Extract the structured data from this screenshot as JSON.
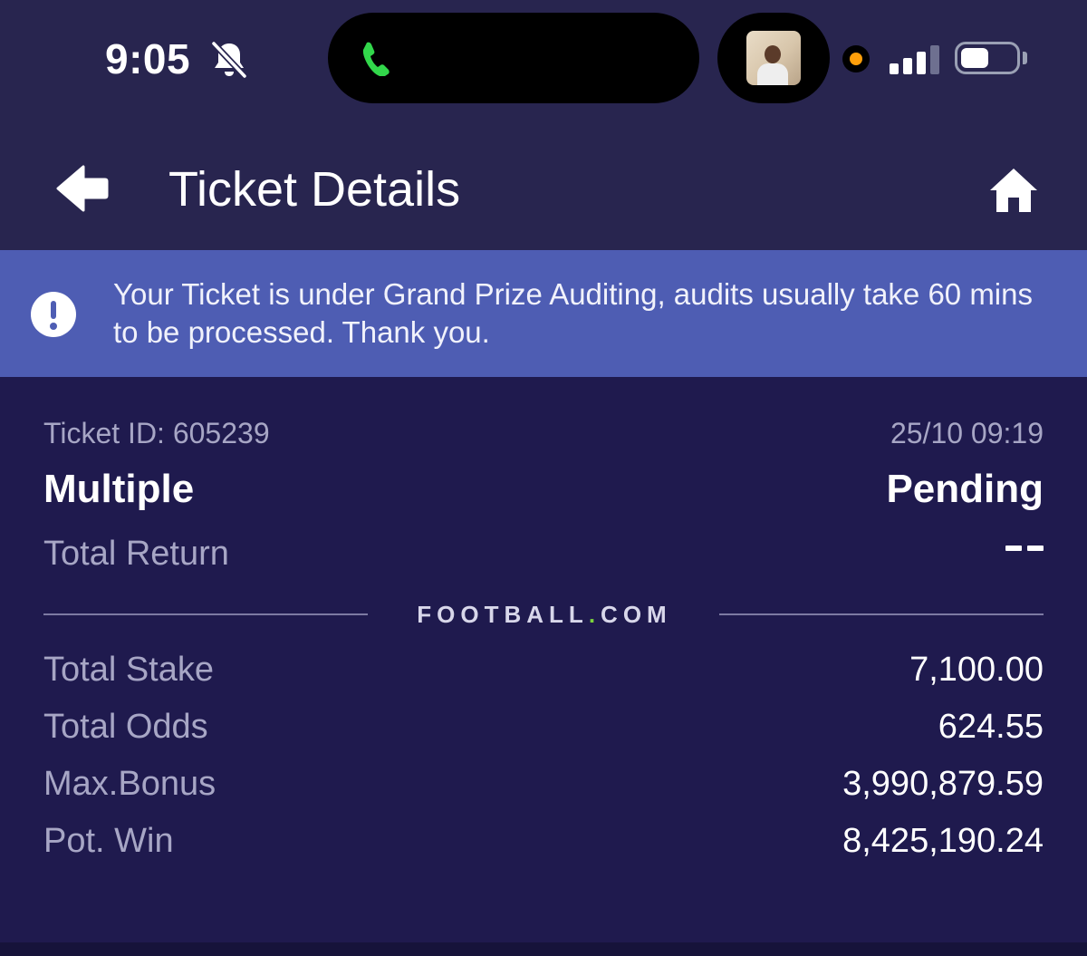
{
  "status_bar": {
    "time": "9:05",
    "icons": [
      "bell-slash-icon",
      "phone-icon",
      "camera-thumbnail",
      "mic-indicator-icon",
      "signal-icon",
      "battery-icon"
    ],
    "call_color": "#32d74b",
    "indicator_color": "#ff9f0a"
  },
  "header": {
    "title": "Ticket Details",
    "back_icon": "arrow-left-icon",
    "home_icon": "home-icon"
  },
  "banner": {
    "icon": "exclamation-icon",
    "text": "Your Ticket is under Grand Prize Auditing, audits usually take 60 mins to be processed. Thank you.",
    "color": "#4e5db3"
  },
  "ticket": {
    "id_label": "Ticket ID: 605239",
    "datetime": "25/10 09:19",
    "type": "Multiple",
    "status": "Pending",
    "total_return_label": "Total Return",
    "total_return_value": "--",
    "brand_left": "FOOTBALL",
    "brand_dot": ".",
    "brand_right": "COM",
    "rows": [
      {
        "label": "Total Stake",
        "value": "7,100.00"
      },
      {
        "label": "Total Odds",
        "value": "624.55"
      },
      {
        "label": "Max.Bonus",
        "value": "3,990,879.59"
      },
      {
        "label": "Pot. Win",
        "value": "8,425,190.24"
      }
    ]
  },
  "colors": {
    "background": "#1f1a4e",
    "header_bg": "#28254f",
    "muted_text": "#a7a6c5"
  }
}
